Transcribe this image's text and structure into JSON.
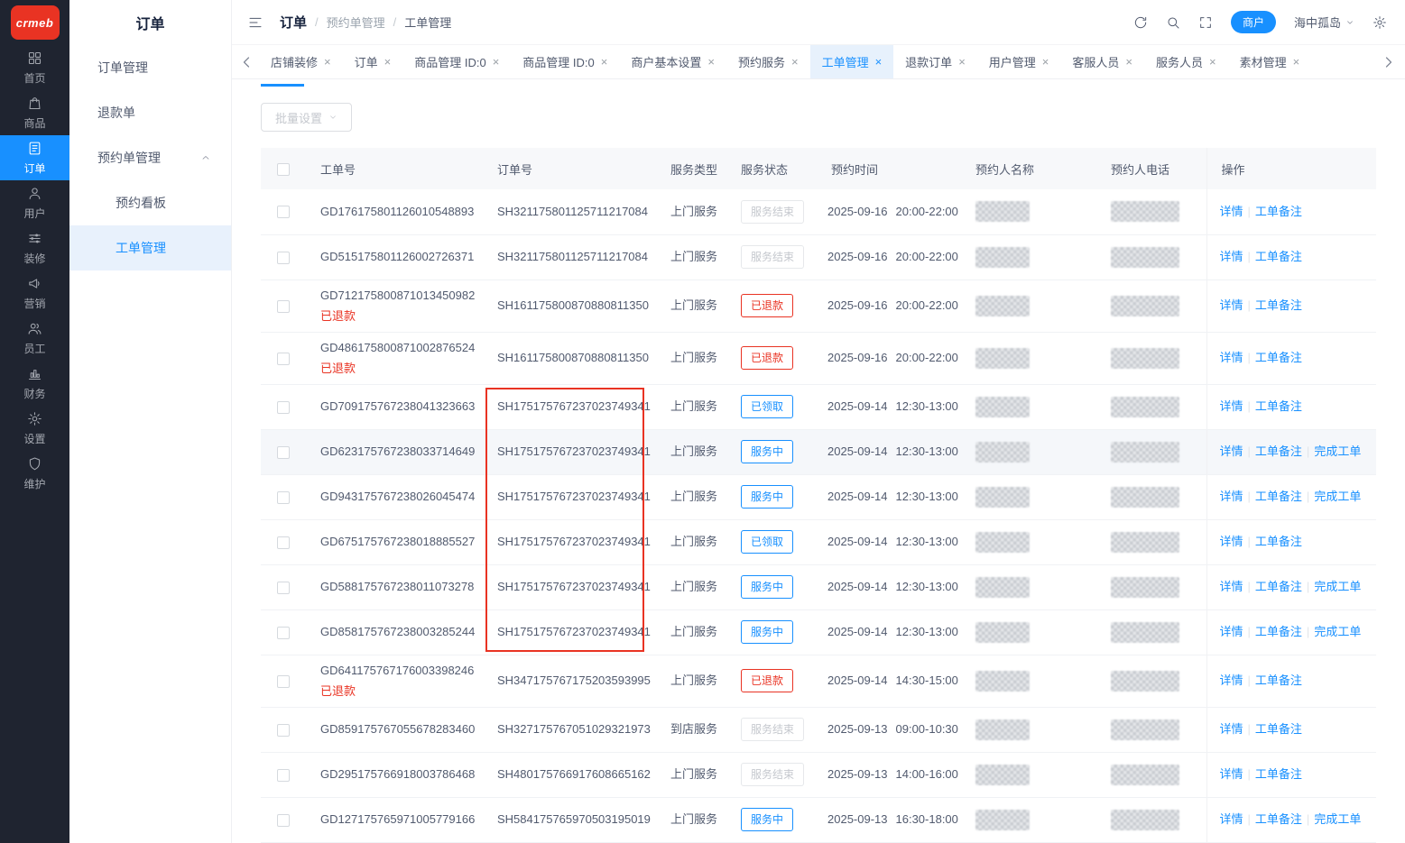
{
  "logo": {
    "text": "crmeb"
  },
  "sidebar": {
    "items": [
      {
        "label": "首页",
        "icon": "home",
        "state": ""
      },
      {
        "label": "商品",
        "icon": "product",
        "state": ""
      },
      {
        "label": "订单",
        "icon": "order",
        "state": "active"
      },
      {
        "label": "用户",
        "icon": "user",
        "state": ""
      },
      {
        "label": "装修",
        "icon": "decorate",
        "state": ""
      },
      {
        "label": "营销",
        "icon": "marketing",
        "state": ""
      },
      {
        "label": "员工",
        "icon": "staff",
        "state": ""
      },
      {
        "label": "财务",
        "icon": "finance",
        "state": ""
      },
      {
        "label": "设置",
        "icon": "settings",
        "state": ""
      },
      {
        "label": "维护",
        "icon": "maintain",
        "state": ""
      }
    ]
  },
  "submenu": {
    "title": "订单",
    "items": [
      {
        "label": "订单管理",
        "state": "",
        "caret": false
      },
      {
        "label": "退款单",
        "state": "",
        "caret": false
      },
      {
        "label": "预约单管理",
        "state": "",
        "caret": true
      },
      {
        "label": "预约看板",
        "state": "child",
        "caret": false
      },
      {
        "label": "工单管理",
        "state": "child active",
        "caret": false
      }
    ]
  },
  "header": {
    "breadcrumb": [
      "订单",
      "预约单管理",
      "工单管理"
    ],
    "separator": "/",
    "merchant_badge": "商户",
    "username": "海中孤岛"
  },
  "tabs": {
    "close": "×",
    "items": [
      {
        "label": "店铺装修",
        "state": ""
      },
      {
        "label": "订单",
        "state": ""
      },
      {
        "label": "商品管理 ID:0",
        "state": ""
      },
      {
        "label": "商品管理 ID:0",
        "state": ""
      },
      {
        "label": "商户基本设置",
        "state": ""
      },
      {
        "label": "预约服务",
        "state": ""
      },
      {
        "label": "工单管理",
        "state": "active"
      },
      {
        "label": "退款订单",
        "state": ""
      },
      {
        "label": "用户管理",
        "state": ""
      },
      {
        "label": "客服人员",
        "state": ""
      },
      {
        "label": "服务人员",
        "state": ""
      },
      {
        "label": "素材管理",
        "state": ""
      }
    ]
  },
  "toolbar": {
    "batch_button": "批量设置"
  },
  "table": {
    "columns": [
      "工单号",
      "订单号",
      "服务类型",
      "服务状态",
      "预约时间",
      "预约人名称",
      "预约人电话",
      "操作"
    ],
    "rows": [
      {
        "work_no": "GD176175801126010548893",
        "refund": "",
        "order_no": "SH321175801125711217084",
        "service_type": "上门服务",
        "status": "服务结束",
        "status_type": "disabled",
        "date": "2025-09-16",
        "time": "20:00-22:00",
        "action_detail": "详情",
        "action_note": "工单备注",
        "action_complete": "",
        "row_state": "",
        "box": ""
      },
      {
        "work_no": "GD515175801126002726371",
        "refund": "",
        "order_no": "SH321175801125711217084",
        "service_type": "上门服务",
        "status": "服务结束",
        "status_type": "disabled",
        "date": "2025-09-16",
        "time": "20:00-22:00",
        "action_detail": "详情",
        "action_note": "工单备注",
        "action_complete": "",
        "row_state": "",
        "box": ""
      },
      {
        "work_no": "GD712175800871013450982",
        "refund": "已退款",
        "order_no": "SH161175800870880811350",
        "service_type": "上门服务",
        "status": "已退款",
        "status_type": "danger",
        "date": "2025-09-16",
        "time": "20:00-22:00",
        "action_detail": "详情",
        "action_note": "工单备注",
        "action_complete": "",
        "row_state": "",
        "box": ""
      },
      {
        "work_no": "GD486175800871002876524",
        "refund": "已退款",
        "order_no": "SH161175800870880811350",
        "service_type": "上门服务",
        "status": "已退款",
        "status_type": "danger",
        "date": "2025-09-16",
        "time": "20:00-22:00",
        "action_detail": "详情",
        "action_note": "工单备注",
        "action_complete": "",
        "row_state": "",
        "box": ""
      },
      {
        "work_no": "GD709175767238041323663",
        "refund": "",
        "order_no": "SH175175767237023749341",
        "service_type": "上门服务",
        "status": "已领取",
        "status_type": "primary",
        "date": "2025-09-14",
        "time": "12:30-13:00",
        "action_detail": "详情",
        "action_note": "工单备注",
        "action_complete": "",
        "row_state": "",
        "box": "redbox redbox-top"
      },
      {
        "work_no": "GD623175767238033714649",
        "refund": "",
        "order_no": "SH175175767237023749341",
        "service_type": "上门服务",
        "status": "服务中",
        "status_type": "primary",
        "date": "2025-09-14",
        "time": "12:30-13:00",
        "action_detail": "详情",
        "action_note": "工单备注",
        "action_complete": "完成工单",
        "row_state": "hover",
        "box": "redbox"
      },
      {
        "work_no": "GD943175767238026045474",
        "refund": "",
        "order_no": "SH175175767237023749341",
        "service_type": "上门服务",
        "status": "服务中",
        "status_type": "primary",
        "date": "2025-09-14",
        "time": "12:30-13:00",
        "action_detail": "详情",
        "action_note": "工单备注",
        "action_complete": "完成工单",
        "row_state": "",
        "box": "redbox"
      },
      {
        "work_no": "GD675175767238018885527",
        "refund": "",
        "order_no": "SH175175767237023749341",
        "service_type": "上门服务",
        "status": "已领取",
        "status_type": "primary",
        "date": "2025-09-14",
        "time": "12:30-13:00",
        "action_detail": "详情",
        "action_note": "工单备注",
        "action_complete": "",
        "row_state": "",
        "box": "redbox"
      },
      {
        "work_no": "GD588175767238011073278",
        "refund": "",
        "order_no": "SH175175767237023749341",
        "service_type": "上门服务",
        "status": "服务中",
        "status_type": "primary",
        "date": "2025-09-14",
        "time": "12:30-13:00",
        "action_detail": "详情",
        "action_note": "工单备注",
        "action_complete": "完成工单",
        "row_state": "",
        "box": "redbox"
      },
      {
        "work_no": "GD858175767238003285244",
        "refund": "",
        "order_no": "SH175175767237023749341",
        "service_type": "上门服务",
        "status": "服务中",
        "status_type": "primary",
        "date": "2025-09-14",
        "time": "12:30-13:00",
        "action_detail": "详情",
        "action_note": "工单备注",
        "action_complete": "完成工单",
        "row_state": "",
        "box": "redbox redbox-bottom"
      },
      {
        "work_no": "GD641175767176003398246",
        "refund": "已退款",
        "order_no": "SH347175767175203593995",
        "service_type": "上门服务",
        "status": "已退款",
        "status_type": "danger",
        "date": "2025-09-14",
        "time": "14:30-15:00",
        "action_detail": "详情",
        "action_note": "工单备注",
        "action_complete": "",
        "row_state": "",
        "box": ""
      },
      {
        "work_no": "GD859175767055678283460",
        "refund": "",
        "order_no": "SH327175767051029321973",
        "service_type": "到店服务",
        "status": "服务结束",
        "status_type": "disabled",
        "date": "2025-09-13",
        "time": "09:00-10:30",
        "action_detail": "详情",
        "action_note": "工单备注",
        "action_complete": "",
        "row_state": "",
        "box": ""
      },
      {
        "work_no": "GD295175766918003786468",
        "refund": "",
        "order_no": "SH480175766917608665162",
        "service_type": "上门服务",
        "status": "服务结束",
        "status_type": "disabled",
        "date": "2025-09-13",
        "time": "14:00-16:00",
        "action_detail": "详情",
        "action_note": "工单备注",
        "action_complete": "",
        "row_state": "",
        "box": ""
      },
      {
        "work_no": "GD127175765971005779166",
        "refund": "",
        "order_no": "SH584175765970503195019",
        "service_type": "上门服务",
        "status": "服务中",
        "status_type": "primary",
        "date": "2025-09-13",
        "time": "16:30-18:00",
        "action_detail": "详情",
        "action_note": "工单备注",
        "action_complete": "完成工单",
        "row_state": "",
        "box": ""
      }
    ]
  }
}
